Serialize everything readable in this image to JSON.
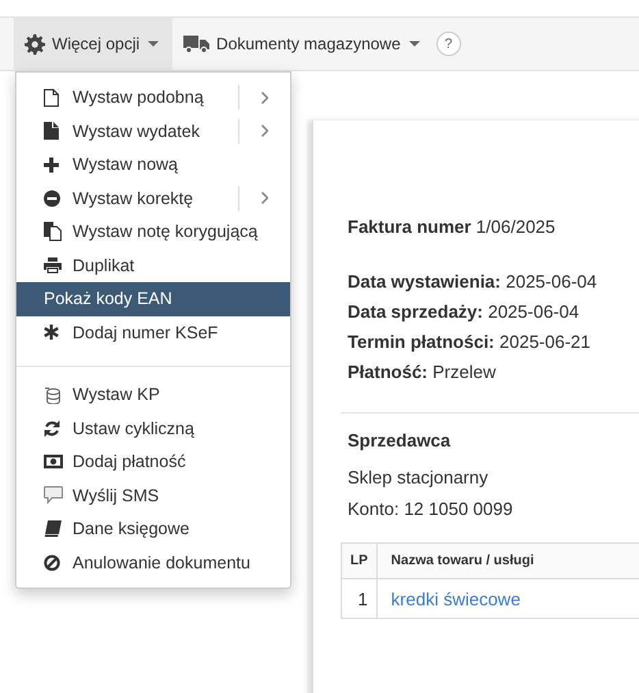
{
  "toolbar": {
    "buttons": [
      {
        "label": "Więcej opcji",
        "kind": "gear",
        "selected": true
      },
      {
        "label": "Dokumenty magazynowe",
        "kind": "truck",
        "selected": false
      }
    ],
    "help": "?"
  },
  "menu": {
    "sections": [
      [
        {
          "label": "Wystaw podobną",
          "kind": "file-outline",
          "submenu": true,
          "selected": false
        },
        {
          "label": "Wystaw wydatek",
          "kind": "file",
          "submenu": true,
          "selected": false
        },
        {
          "label": "Wystaw nową",
          "kind": "plus",
          "submenu": false,
          "selected": false
        },
        {
          "label": "Wystaw korektę",
          "kind": "minus-circle",
          "submenu": true,
          "selected": false
        },
        {
          "label": "Wystaw notę korygującą",
          "kind": "copy",
          "submenu": false,
          "selected": false
        },
        {
          "label": "Duplikat",
          "kind": "print",
          "submenu": false,
          "selected": false
        },
        {
          "label": "Pokaż kody EAN",
          "kind": "plain",
          "submenu": false,
          "selected": true
        },
        {
          "label": "Dodaj numer KSeF",
          "kind": "asterisk",
          "submenu": false,
          "selected": false
        }
      ],
      [
        {
          "label": "Wystaw KP",
          "kind": "database",
          "submenu": false,
          "selected": false
        },
        {
          "label": "Ustaw cykliczną",
          "kind": "refresh",
          "submenu": false,
          "selected": false
        },
        {
          "label": "Dodaj płatność",
          "kind": "money",
          "submenu": false,
          "selected": false
        },
        {
          "label": "Wyślij SMS",
          "kind": "sms",
          "submenu": false,
          "selected": false
        },
        {
          "label": "Dane księgowe",
          "kind": "book",
          "submenu": false,
          "selected": false
        },
        {
          "label": "Anulowanie dokumentu",
          "kind": "ban",
          "submenu": false,
          "selected": false
        }
      ]
    ]
  },
  "document": {
    "title": {
      "label": "Faktura numer",
      "value": "1/06/2025"
    },
    "fields": [
      {
        "label": "Data wystawienia:",
        "value": "2025-06-04"
      },
      {
        "label": "Data sprzedaży:",
        "value": "2025-06-04"
      },
      {
        "label": "Termin płatności:",
        "value": "2025-06-21"
      },
      {
        "label": "Płatność:",
        "value": "Przelew"
      }
    ],
    "seller": {
      "heading": "Sprzedawca",
      "name": "Sklep stacjonarny",
      "account": "Konto: 12 1050 0099"
    },
    "table": {
      "columns": [
        "LP",
        "Nazwa towaru / usługi"
      ],
      "rows": [
        [
          "1",
          "kredki świecowe"
        ]
      ]
    }
  }
}
